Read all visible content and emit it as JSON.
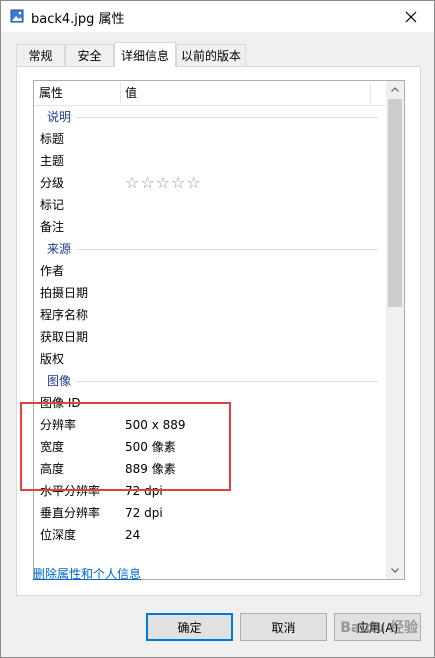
{
  "window": {
    "title": "back4.jpg 属性"
  },
  "tabs": [
    {
      "label": "常规"
    },
    {
      "label": "安全"
    },
    {
      "label": "详细信息"
    },
    {
      "label": "以前的版本"
    }
  ],
  "list": {
    "headers": {
      "property": "属性",
      "value": "值"
    },
    "sections": [
      {
        "title": "说明",
        "rows": [
          {
            "name": "标题",
            "value": ""
          },
          {
            "name": "主题",
            "value": ""
          },
          {
            "name": "分级",
            "value": ""
          },
          {
            "name": "标记",
            "value": ""
          },
          {
            "name": "备注",
            "value": ""
          }
        ]
      },
      {
        "title": "来源",
        "rows": [
          {
            "name": "作者",
            "value": ""
          },
          {
            "name": "拍摄日期",
            "value": ""
          },
          {
            "name": "程序名称",
            "value": ""
          },
          {
            "name": "获取日期",
            "value": ""
          },
          {
            "name": "版权",
            "value": ""
          }
        ]
      },
      {
        "title": "图像",
        "rows": [
          {
            "name": "图像 ID",
            "value": ""
          },
          {
            "name": "分辨率",
            "value": "500 x 889"
          },
          {
            "name": "宽度",
            "value": "500 像素"
          },
          {
            "name": "高度",
            "value": "889 像素"
          },
          {
            "name": "水平分辨率",
            "value": "72 dpi"
          },
          {
            "name": "垂直分辨率",
            "value": "72 dpi"
          },
          {
            "name": "位深度",
            "value": "24"
          }
        ]
      }
    ],
    "rating": {
      "stars_text": "☆☆☆☆☆",
      "filled": 0,
      "max": 5
    }
  },
  "remove_link": "删除属性和个人信息",
  "buttons": {
    "ok": "确定",
    "cancel": "取消",
    "apply": "应用(A)"
  },
  "watermark": "Baidu 经验",
  "colors": {
    "accent": "#0078d7",
    "section_header": "#1e3b8c",
    "link": "#0066cc",
    "highlight_box": "#e0403f"
  }
}
